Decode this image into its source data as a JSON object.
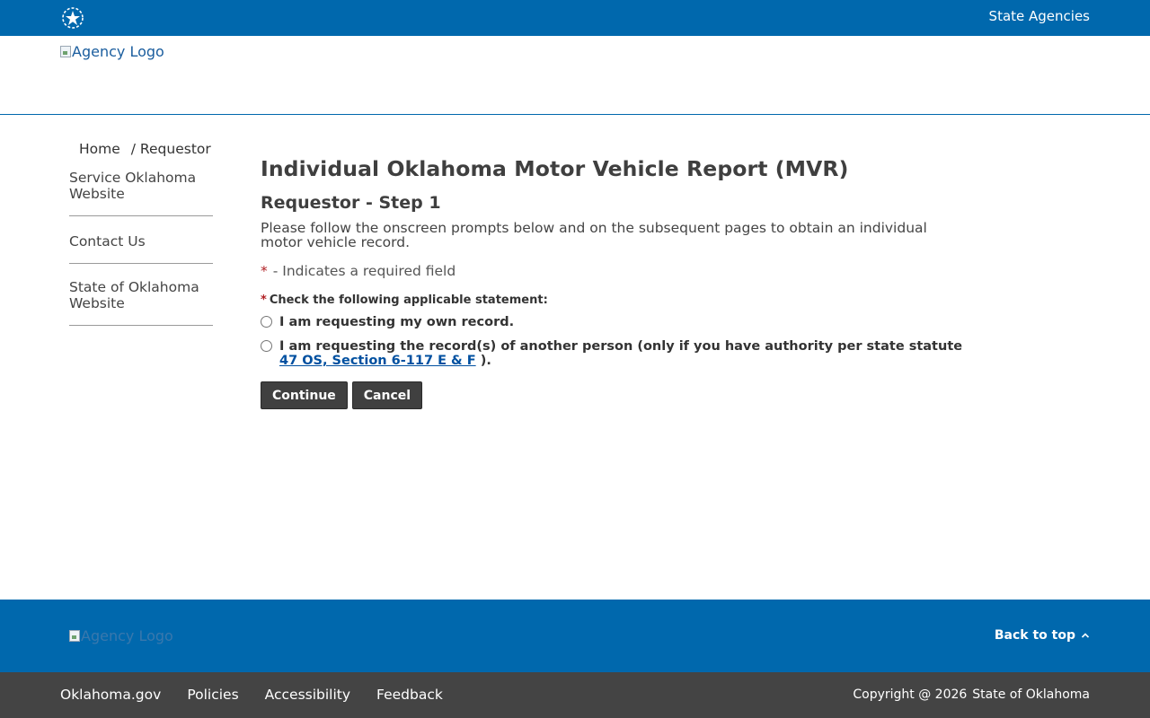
{
  "topbar": {
    "state_agencies_label": "State Agencies",
    "logo_icon": "star-seal-icon"
  },
  "header": {
    "agency_logo_alt": "Agency Logo"
  },
  "breadcrumb": {
    "home": "Home",
    "current": "/ Requestor"
  },
  "sidebar": {
    "items": [
      {
        "label": "Service Oklahoma Website"
      },
      {
        "label": "Contact Us"
      },
      {
        "label": "State of Oklahoma Website"
      }
    ]
  },
  "main": {
    "title": "Individual Oklahoma Motor Vehicle Report (MVR)",
    "step_title": "Requestor - Step 1",
    "instructions": "Please follow the onscreen prompts below and on the subsequent pages to obtain an individual motor vehicle record.",
    "required_marker": "*",
    "required_note": "- Indicates a required field",
    "question": "Check the following applicable statement:",
    "options": [
      {
        "label": "I am requesting my own record.",
        "selected": false
      },
      {
        "label_prefix": "I am requesting the record(s) of another person (only if you have authority per state statute",
        "link_text": "47 OS, Section 6-117 E & F",
        "label_suffix": ").",
        "selected": false
      }
    ],
    "continue_label": "Continue",
    "cancel_label": "Cancel"
  },
  "footer": {
    "logo_alt": "Agency Logo",
    "back_to_top": "Back to top",
    "links": [
      "Oklahoma.gov",
      "Policies",
      "Accessibility",
      "Feedback"
    ],
    "copyright_prefix": "Copyright @ 2026",
    "copyright_owner": "State of Oklahoma"
  },
  "colors": {
    "brand_blue": "#0068ad",
    "button_dark": "#404040",
    "bottom_bar": "#444444",
    "required_red": "#b01e23"
  }
}
